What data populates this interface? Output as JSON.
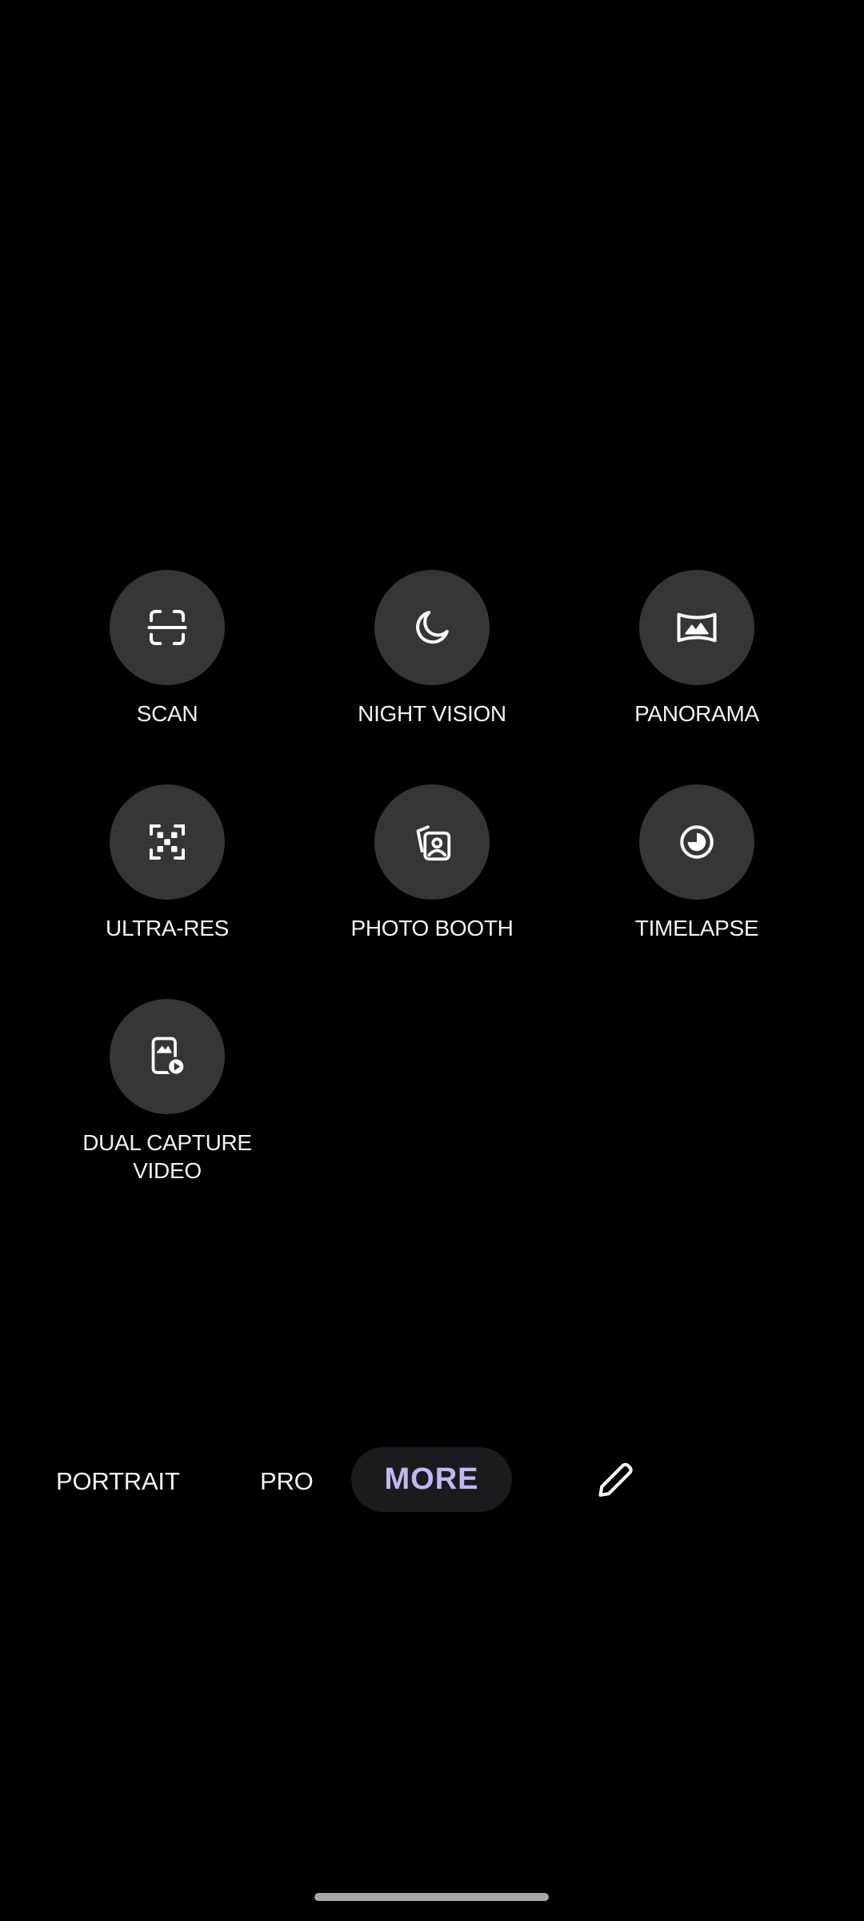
{
  "modes": [
    {
      "label": "SCAN",
      "icon": "scan-icon"
    },
    {
      "label": "NIGHT VISION",
      "icon": "moon-icon"
    },
    {
      "label": "PANORAMA",
      "icon": "panorama-icon"
    },
    {
      "label": "ULTRA-RES",
      "icon": "ultra-res-grid-icon"
    },
    {
      "label": "PHOTO BOOTH",
      "icon": "photo-booth-icon"
    },
    {
      "label": "TIMELAPSE",
      "icon": "timelapse-icon"
    },
    {
      "label": "DUAL CAPTURE VIDEO",
      "icon": "dual-capture-video-icon"
    }
  ],
  "mode_bar": {
    "items": [
      "PORTRAIT",
      "PRO"
    ],
    "selected": "MORE",
    "edit_icon": "pencil-icon"
  },
  "colors": {
    "background": "#000000",
    "mode_circle": "#363636",
    "selected_text": "#c5b7f2",
    "selected_pill": "#1b1b1e"
  }
}
